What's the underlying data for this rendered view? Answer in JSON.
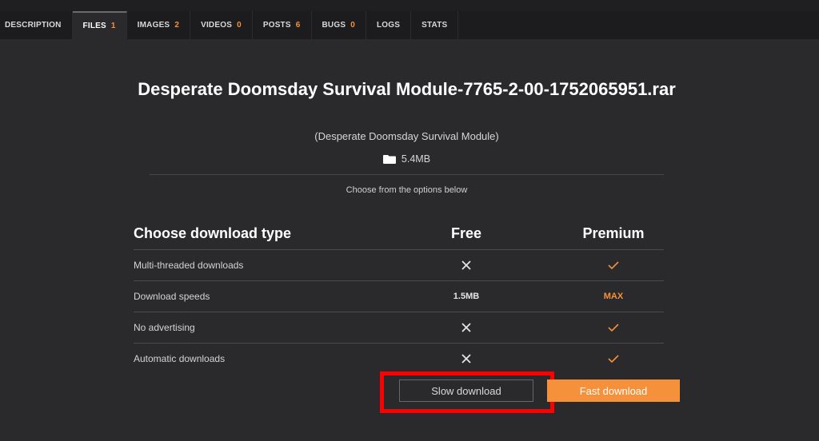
{
  "tabs": [
    {
      "label": "DESCRIPTION",
      "count": ""
    },
    {
      "label": "FILES",
      "count": "1"
    },
    {
      "label": "IMAGES",
      "count": "2"
    },
    {
      "label": "VIDEOS",
      "count": "0"
    },
    {
      "label": "POSTS",
      "count": "6"
    },
    {
      "label": "BUGS",
      "count": "0"
    },
    {
      "label": "LOGS",
      "count": ""
    },
    {
      "label": "STATS",
      "count": ""
    }
  ],
  "active_tab": "FILES",
  "file": {
    "title": "Desperate Doomsday Survival Module-7765-2-00-1752065951.rar",
    "subtitle": "(Desperate Doomsday Survival Module)",
    "size": "5.4MB",
    "size_icon": "folder-icon"
  },
  "instructions": "Choose from the options below",
  "table": {
    "header": {
      "label": "Choose download type",
      "free": "Free",
      "premium": "Premium"
    },
    "rows": [
      {
        "label": "Multi-threaded downloads",
        "free": "✕",
        "premium": "✓"
      },
      {
        "label": "Download speeds",
        "free": "1.5MB",
        "premium": "MAX"
      },
      {
        "label": "No advertising",
        "free": "✕",
        "premium": "✓"
      },
      {
        "label": "Automatic downloads",
        "free": "✕",
        "premium": "✓"
      }
    ]
  },
  "buttons": {
    "slow": "Slow download",
    "fast": "Fast download"
  },
  "colors": {
    "accent": "#f5913a",
    "highlight": "#ff0000",
    "background": "#2a2a2d"
  }
}
